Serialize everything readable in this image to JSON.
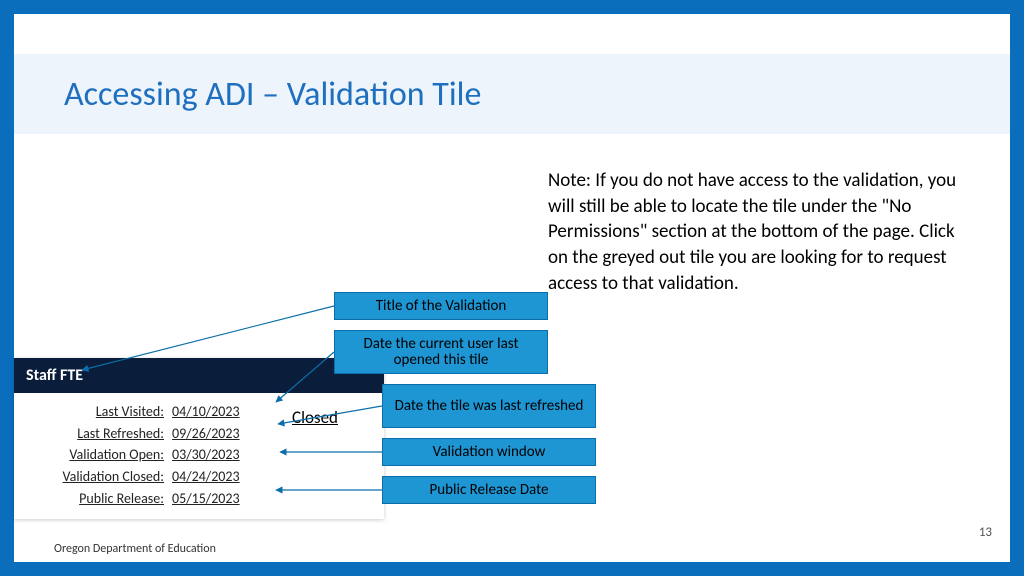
{
  "slide": {
    "title": "Accessing ADI – Validation Tile",
    "note": "Note: If you do not have access to the validation, you will still be able to locate the tile under the \"No Permissions\" section at the bottom of the page. Click on the greyed out tile you are looking for to request access to that validation.",
    "footer": "Oregon Department of Education",
    "page_number": "13"
  },
  "tile": {
    "title": "Staff FTE",
    "status": "Closed",
    "rows": {
      "last_visited_label": "Last Visited:",
      "last_visited_value": "04/10/2023",
      "last_refreshed_label": "Last Refreshed:",
      "last_refreshed_value": "09/26/2023",
      "validation_open_label": "Validation Open:",
      "validation_open_value": "03/30/2023",
      "validation_closed_label": "Validation Closed:",
      "validation_closed_value": "04/24/2023",
      "public_release_label": "Public Release:",
      "public_release_value": "05/15/2023"
    }
  },
  "callouts": {
    "title": "Title of the Validation",
    "last_visited": "Date the current user last opened this tile",
    "last_refreshed": "Date the tile was last refreshed",
    "validation_window": "Validation window",
    "public_release": "Public Release Date"
  }
}
